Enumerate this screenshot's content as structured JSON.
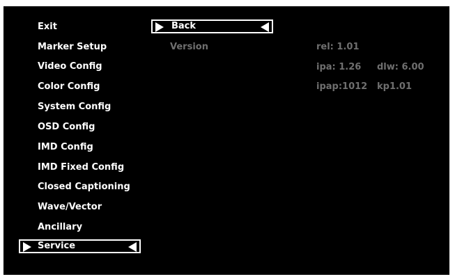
{
  "left_menu": {
    "items": [
      {
        "label": "Exit"
      },
      {
        "label": "Marker Setup"
      },
      {
        "label": "Video Config"
      },
      {
        "label": "Color Config"
      },
      {
        "label": "System Config"
      },
      {
        "label": "OSD Config"
      },
      {
        "label": "IMD Config"
      },
      {
        "label": "IMD Fixed Config"
      },
      {
        "label": "Closed Captioning"
      },
      {
        "label": "Wave/Vector"
      },
      {
        "label": "Ancillary"
      },
      {
        "label": "Service"
      }
    ],
    "selected_index": 11
  },
  "sub_menu": {
    "back_label": "Back",
    "version_label": "Version"
  },
  "version_info": {
    "rel": "rel: 1.01",
    "ipa": "ipa: 1.26",
    "dlw": "dlw: 6.00",
    "ipap": "ipap:1012",
    "kp": "kp1.01"
  },
  "colors": {
    "background": "#000000",
    "text": "#ffffff",
    "disabled_text": "#6f6f6f"
  }
}
